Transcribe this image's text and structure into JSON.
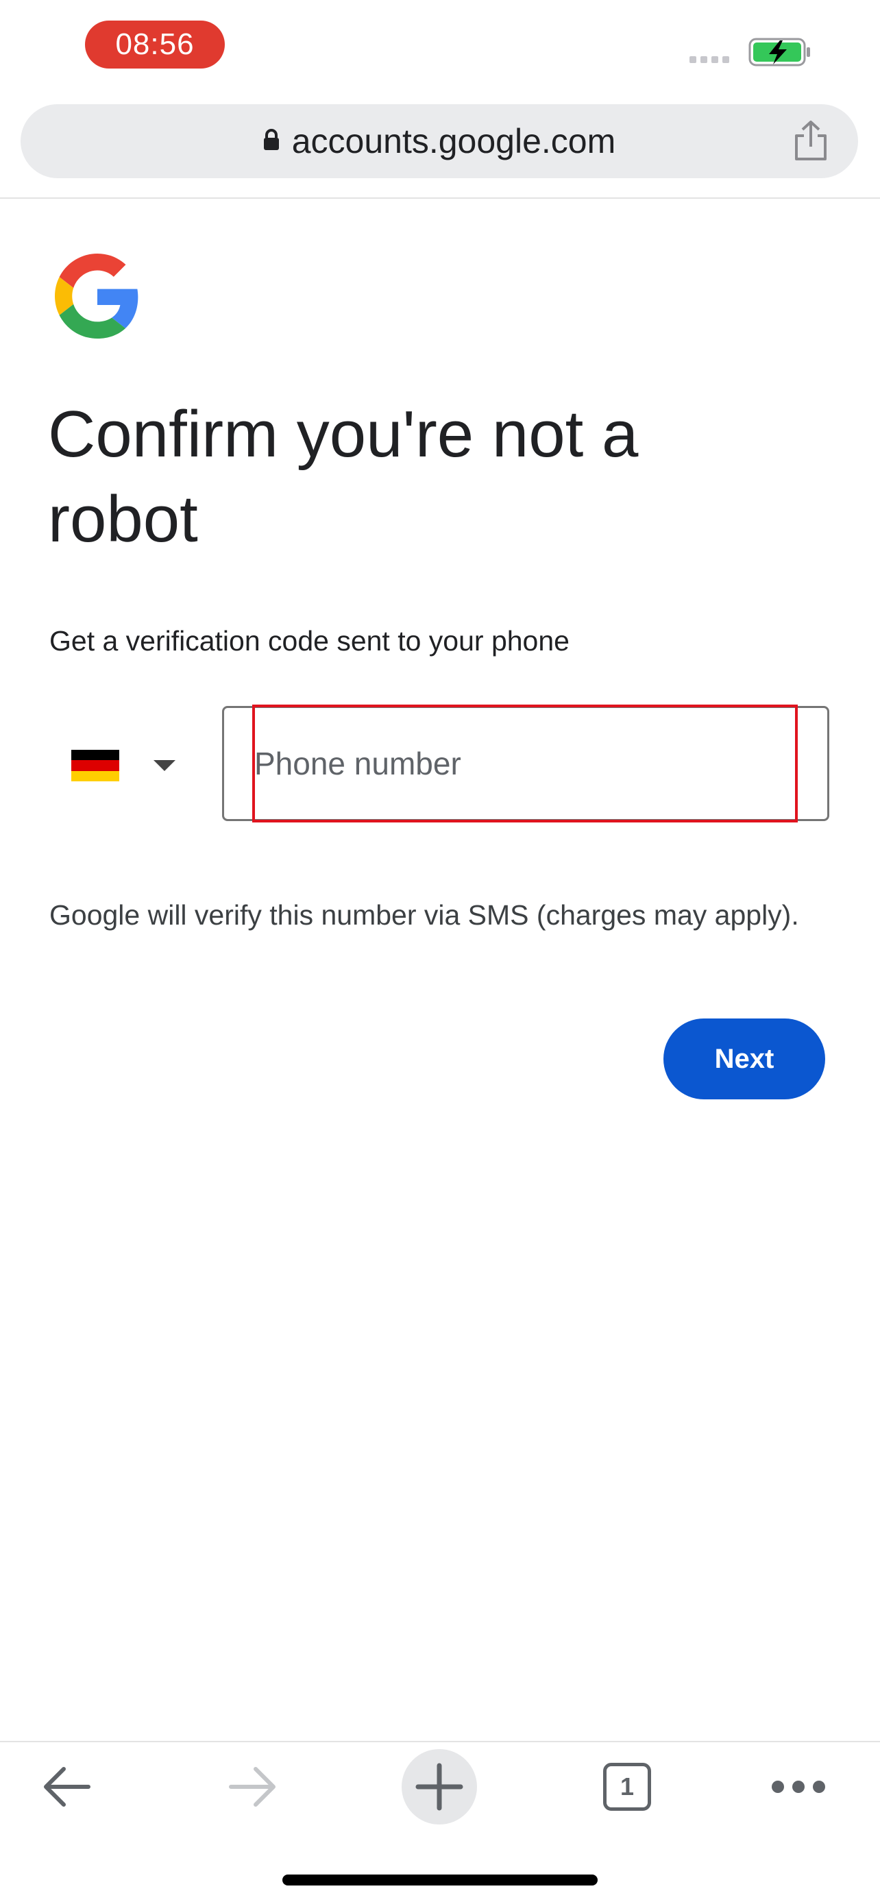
{
  "status_bar": {
    "time": "08:56",
    "time_pill_color": "#e03a2f",
    "battery_state": "charging",
    "battery_color": "#34c759"
  },
  "browser": {
    "url": "accounts.google.com",
    "icons": [
      "lock-icon",
      "share-icon"
    ]
  },
  "page": {
    "logo": "google-g-logo",
    "title": "Confirm you're not a robot",
    "subtitle": "Get a verification code sent to your phone",
    "country": {
      "flag": "germany-flag-icon",
      "colors": [
        "#000000",
        "#dd0000",
        "#ffce00"
      ]
    },
    "phone_input": {
      "placeholder": "Phone number",
      "value": ""
    },
    "highlight_color": "#e0141e",
    "sms_note": "Google will verify this number via SMS (charges may apply).",
    "next_label": "Next",
    "accent_color": "#0b57d0"
  },
  "toolbar": {
    "items": [
      "back-icon",
      "forward-icon",
      "new-tab-icon",
      "tab-switcher",
      "more-icon"
    ],
    "tab_count": "1"
  }
}
